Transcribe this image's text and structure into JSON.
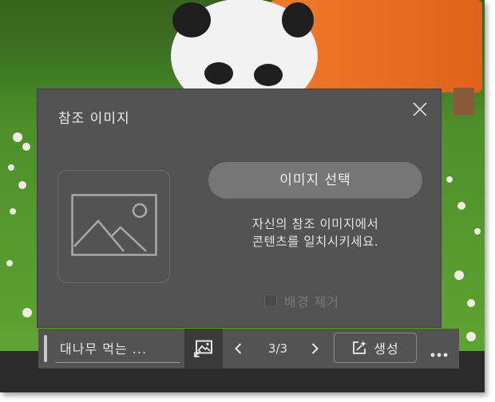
{
  "panel": {
    "title": "참조 이미지",
    "select_image_label": "이미지 선택",
    "description_line1": "자신의 참조 이미지에서",
    "description_line2": "콘텐츠를 일치시키세요.",
    "remove_background_label": "배경 제거",
    "remove_background_checked": false
  },
  "toolbar": {
    "prompt_text": "대나무 먹는 ...",
    "counter": "3/3",
    "generate_label": "생성"
  },
  "icons": {
    "close": "close-icon",
    "placeholder": "image-placeholder-icon",
    "reference_image": "reference-image-icon",
    "prev": "chevron-left-icon",
    "next": "chevron-right-icon",
    "generate": "sparkle-edit-icon",
    "more": "more-horizontal-icon"
  },
  "colors": {
    "panel_bg": "#535353",
    "button_bg": "#767676",
    "text": "#e6e6e6",
    "disabled_text": "#7a7a7a"
  }
}
